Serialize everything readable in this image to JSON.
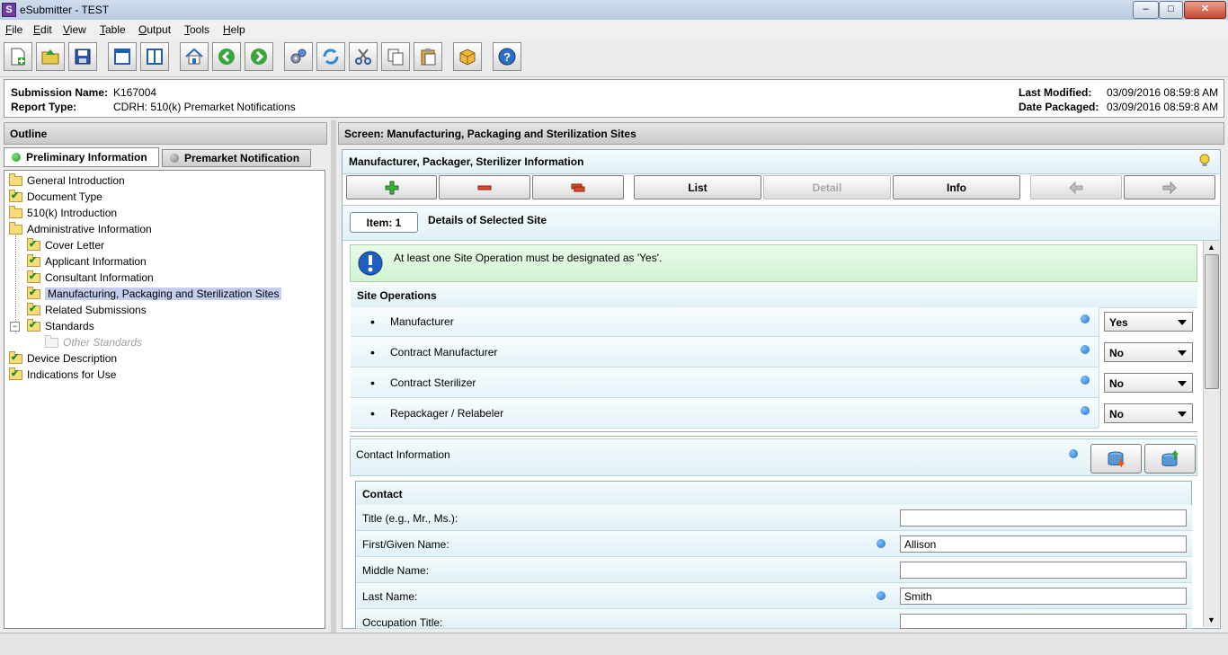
{
  "window": {
    "title": "eSubmitter - TEST",
    "app_icon_letter": "S",
    "min": "–",
    "max": "□",
    "close": "✕"
  },
  "menu": [
    "File",
    "Edit",
    "View",
    "Table",
    "Output",
    "Tools",
    "Help"
  ],
  "submission": {
    "name_label": "Submission Name:",
    "name_value": "K167004",
    "type_label": "Report Type:",
    "type_value": "CDRH: 510(k) Premarket Notifications",
    "modified_label": "Last Modified:",
    "modified_value": "03/09/2016 08:59:8 AM",
    "packaged_label": "Date Packaged:",
    "packaged_value": "03/09/2016 08:59:8 AM"
  },
  "outline": {
    "header": "Outline",
    "tab_active": "Preliminary Information",
    "tab_inactive": "Premarket Notification",
    "tree": {
      "general_intro": "General Introduction",
      "document_type": "Document Type",
      "intro_510k": "510(k) Introduction",
      "admin_info": "Administrative Information",
      "cover_letter": "Cover Letter",
      "applicant_info": "Applicant Information",
      "consultant_info": "Consultant Information",
      "mfg_sites": "Manufacturing, Packaging and Sterilization Sites",
      "related_subs": "Related Submissions",
      "standards": "Standards",
      "other_standards": "Other Standards",
      "device_desc": "Device Description",
      "indications": "Indications for Use"
    }
  },
  "screen": {
    "title": "Screen: Manufacturing, Packaging and Sterilization Sites",
    "section_title": "Manufacturer, Packager, Sterilizer Information",
    "buttons": {
      "list": "List",
      "detail": "Detail",
      "info": "Info"
    },
    "item_label": "Item: 1",
    "details_label": "Details of Selected Site",
    "notice": "At least one Site Operation must be designated as 'Yes'.",
    "site_ops_header": "Site Operations",
    "site_ops": [
      {
        "label": "Manufacturer",
        "value": "Yes"
      },
      {
        "label": "Contract Manufacturer",
        "value": "No"
      },
      {
        "label": "Contract Sterilizer",
        "value": "No"
      },
      {
        "label": "Repackager / Relabeler",
        "value": "No"
      }
    ],
    "contact_section": "Contact Information",
    "contact_header": "Contact",
    "contact_fields": [
      {
        "label": "Title (e.g., Mr., Ms.):",
        "value": ""
      },
      {
        "label": "First/Given Name:",
        "value": "Allison"
      },
      {
        "label": "Middle Name:",
        "value": ""
      },
      {
        "label": "Last Name:",
        "value": "Smith"
      },
      {
        "label": "Occupation Title:",
        "value": ""
      }
    ]
  }
}
